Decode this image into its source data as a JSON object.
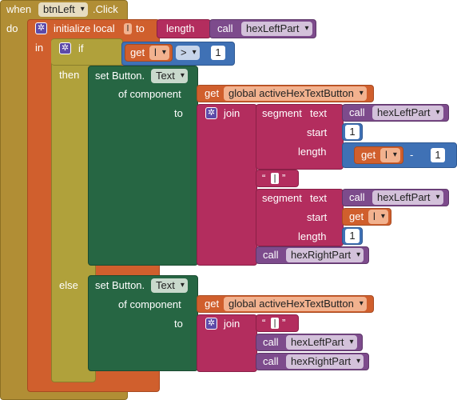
{
  "event": {
    "when": "when",
    "component": "btnLeft",
    "click": ".Click",
    "do": "do"
  },
  "init_local": {
    "label": "initialize local",
    "var": "l",
    "to": "to",
    "in": "in"
  },
  "length_block": {
    "label": "length"
  },
  "call1": {
    "call": "call",
    "proc": "hexLeftPart"
  },
  "if_block": {
    "if": "if",
    "then": "then",
    "else": "else"
  },
  "compare": {
    "get": "get",
    "var": "l",
    "op": ">",
    "value": "1"
  },
  "then_set": {
    "set": "set Button.",
    "prop": "Text",
    "of_component": "of component",
    "to": "to",
    "get_global": "get",
    "global_var": "global activeHexTextButton",
    "join": "join",
    "segment": {
      "label": "segment",
      "text": "text",
      "start": "start",
      "length": "length",
      "call": "call",
      "proc": "hexLeftPart",
      "start_val": "1",
      "get": "get",
      "var": "l",
      "minus": "-",
      "sub_val": "1"
    },
    "quote_text": "|",
    "segment2": {
      "label": "segment",
      "text": "text",
      "start": "start",
      "length": "length",
      "call": "call",
      "proc": "hexLeftPart",
      "get": "get",
      "var": "l",
      "len_val": "1"
    },
    "call_right": {
      "call": "call",
      "proc": "hexRightPart"
    }
  },
  "else_set": {
    "set": "set Button.",
    "prop": "Text",
    "of_component": "of component",
    "to": "to",
    "get_global": "get",
    "global_var": "global activeHexTextButton",
    "join": "join",
    "quote_text": "|",
    "call_left": {
      "call": "call",
      "proc": "hexLeftPart"
    },
    "call_right": {
      "call": "call",
      "proc": "hexRightPart"
    }
  },
  "colors": {
    "event": "#b18e35",
    "local": "#d05f2d",
    "control": "#b0a13b",
    "setter": "#266643",
    "text": "#b32d5e",
    "procedure": "#7d4b8c",
    "math": "#3f71b5"
  }
}
